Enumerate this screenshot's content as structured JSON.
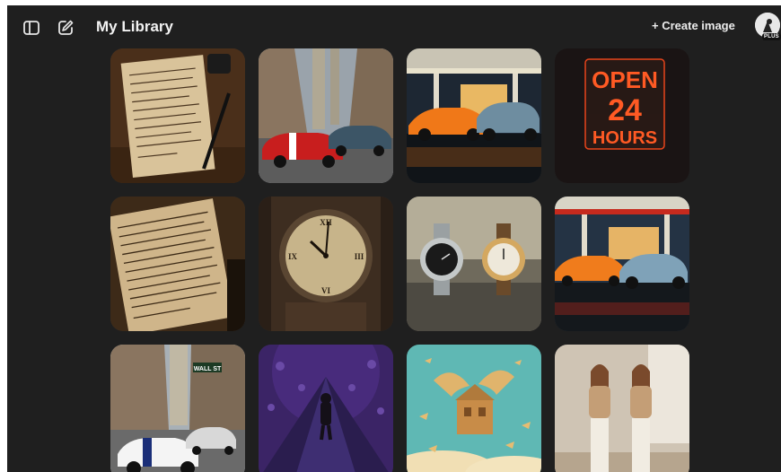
{
  "header": {
    "title": "My Library",
    "create_label": "+ Create image",
    "badge": "PLUS",
    "icons": [
      "sidebar-toggle-icon",
      "new-chat-icon",
      "user-avatar-icon"
    ]
  },
  "colors": {
    "background": "#1f1f1f",
    "text": "#f2f2f2",
    "neon": "#ff4a1c"
  },
  "neon_sign": {
    "line1": "OPEN",
    "line2": "24",
    "line3": "HOURS"
  },
  "street_sign": "WALL ST"
}
